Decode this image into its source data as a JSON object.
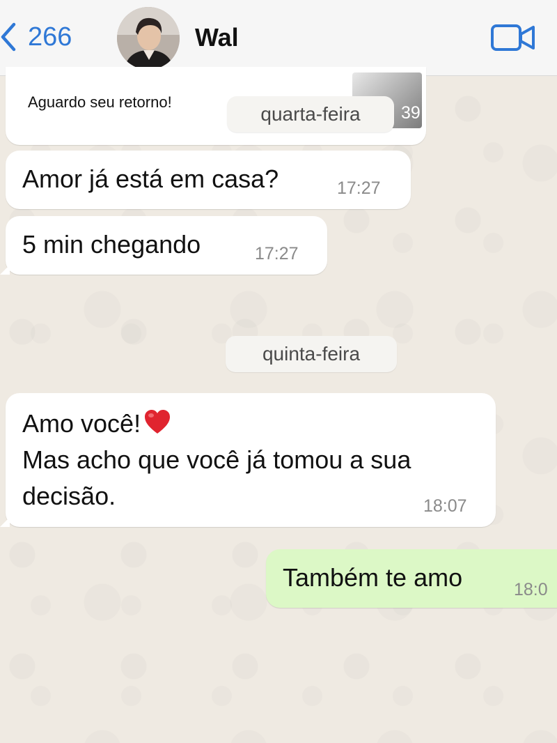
{
  "header": {
    "back_count": "266",
    "contact_name": "Wal"
  },
  "messages": [
    {
      "direction": "in",
      "text": "Aguardo seu retorno!",
      "time_partial": "39"
    },
    {
      "direction": "in",
      "text": "Amor já está em casa?",
      "time": "17:27"
    },
    {
      "direction": "in",
      "text": "5 min chegando",
      "time": "17:27"
    },
    {
      "direction": "in",
      "lines": [
        "Amo você!",
        "Mas acho que você já tomou a sua",
        "decisão."
      ],
      "emoji": "heart",
      "time": "18:07"
    },
    {
      "direction": "out",
      "text": "Também te amo",
      "time": "18:0"
    }
  ],
  "dates": {
    "wednesday": "quarta-feira",
    "thursday": "quinta-feira"
  },
  "colors": {
    "accent": "#2f78d6",
    "incoming_bubble": "#ffffff",
    "outgoing_bubble": "#dcf8c6",
    "chat_background": "#efeae2",
    "heart": "#e0242f"
  },
  "icons": {
    "back": "chevron-left-icon",
    "video_call": "video-camera-icon",
    "emoji": "red-heart-emoji"
  }
}
